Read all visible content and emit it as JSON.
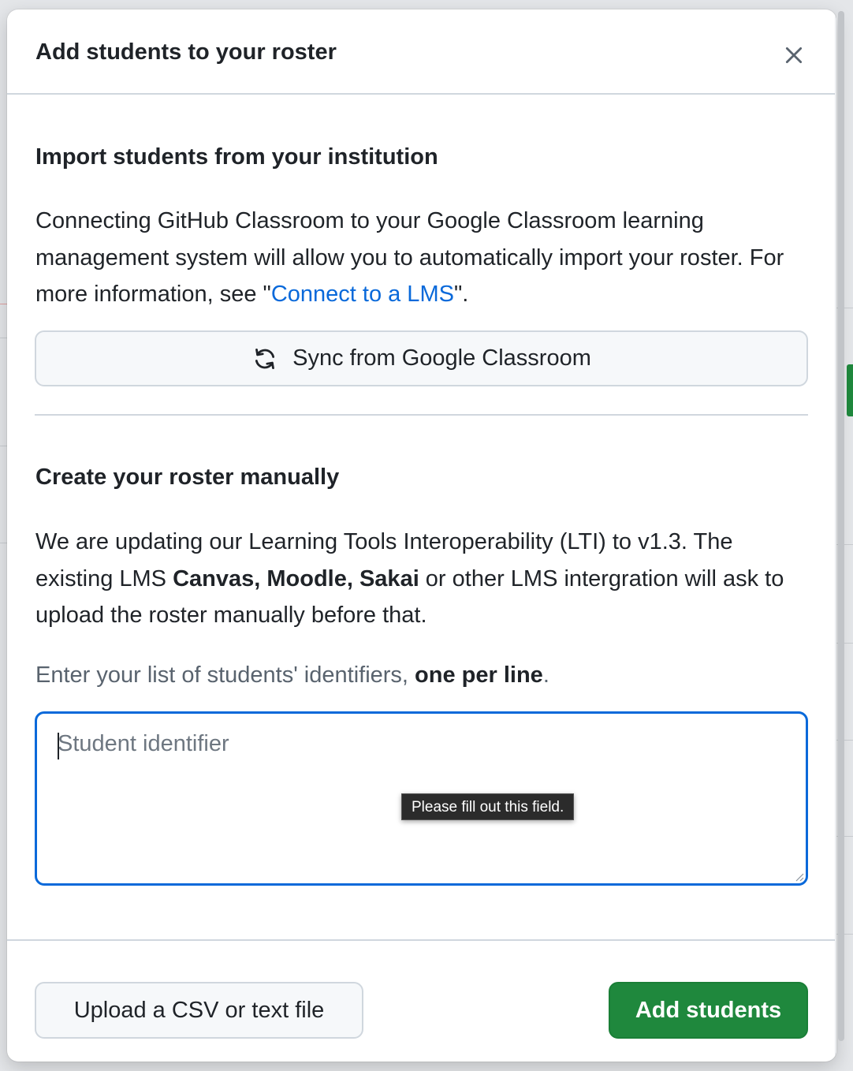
{
  "dialog": {
    "title": "Add students to your roster",
    "close_label": "Close"
  },
  "import_section": {
    "heading": "Import students from your institution",
    "text_before_link": "Connecting GitHub Classroom to your Google Classroom learning management system will allow you to automatically import your roster. For more information, see \"",
    "link_text": "Connect to a LMS",
    "text_after_link": "\".",
    "sync_button_label": "Sync from Google Classroom",
    "sync_icon": "sync-icon"
  },
  "manual_section": {
    "heading": "Create your roster manually",
    "notice_part1": "We are updating our Learning Tools Interoperability (LTI) to v1.3. The existing LMS ",
    "notice_bold": "Canvas, Moodle, Sakai",
    "notice_part2": " or other LMS intergration will ask to upload the roster manually before that.",
    "hint_part1": "Enter your list of students' identifiers, ",
    "hint_bold": "one per line",
    "hint_part2": ".",
    "textarea_placeholder": "Student identifier",
    "textarea_value": "",
    "validation_tooltip": "Please fill out this field."
  },
  "footer": {
    "upload_label": "Upload a CSV or text file",
    "add_label": "Add students"
  },
  "colors": {
    "link": "#0969da",
    "primary_button": "#1f883d",
    "focus_border": "#0969da"
  }
}
